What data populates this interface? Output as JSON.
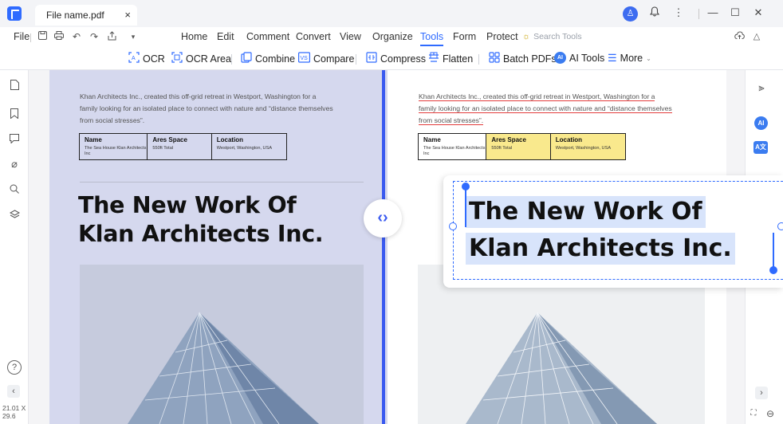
{
  "tab": {
    "title": "File name.pdf",
    "close": "×"
  },
  "titlebar": {
    "avatar": "♙",
    "bell": "🔔",
    "more": "⋮",
    "minimize": "—",
    "maximize": "☐",
    "close": "✕"
  },
  "menu": {
    "file": "File",
    "items": [
      "Home",
      "Edit",
      "Comment",
      "Convert",
      "View",
      "Organize",
      "Tools",
      "Form",
      "Protect"
    ],
    "active": "Tools",
    "search_placeholder": "Search Tools",
    "quick_icons": [
      "save-icon",
      "print-icon",
      "undo-icon",
      "redo-icon",
      "share-icon",
      "dropdown-icon"
    ]
  },
  "toolbar": {
    "ocr": "OCR",
    "ocr_area": "OCR Area",
    "combine": "Combine",
    "compare": "Compare",
    "compress": "Compress",
    "flatten": "Flatten",
    "batch": "Batch PDFs",
    "ai_tools": "AI Tools",
    "more": "More"
  },
  "left_sidebar": {
    "icons": [
      "page-thumbnail-icon",
      "bookmark-icon",
      "comment-icon",
      "attachment-icon",
      "search-icon",
      "layers-icon"
    ],
    "help": "?",
    "collapse": "‹",
    "page_size": "21.01 X 29.6"
  },
  "right_sidebar": {
    "properties": "⫸",
    "ai": "AI",
    "translate": "A文",
    "expand": "›",
    "fit": "⛶",
    "zoom": "⊖"
  },
  "doc": {
    "intro_lines": [
      "Khan Architects Inc., created this off-grid retreat in Westport, Washington for a",
      "family looking for an isolated place to connect with nature and “distance themselves",
      "from social stresses”."
    ],
    "table": {
      "headers": [
        "Name",
        "Ares Space",
        "Location"
      ],
      "values": [
        "The Sea House Klan Architects Inc",
        "550ft Total",
        "Westport, Washington, USA"
      ]
    },
    "headline": [
      "The New Work Of",
      "Klan Architects Inc."
    ]
  },
  "compare_handle": "‹›",
  "colors": {
    "accent": "#2f6bff",
    "divider": "#3a5af0",
    "left_page": "#d5d8ee",
    "highlight": "#f9e98d",
    "underline": "#e23b3b"
  }
}
